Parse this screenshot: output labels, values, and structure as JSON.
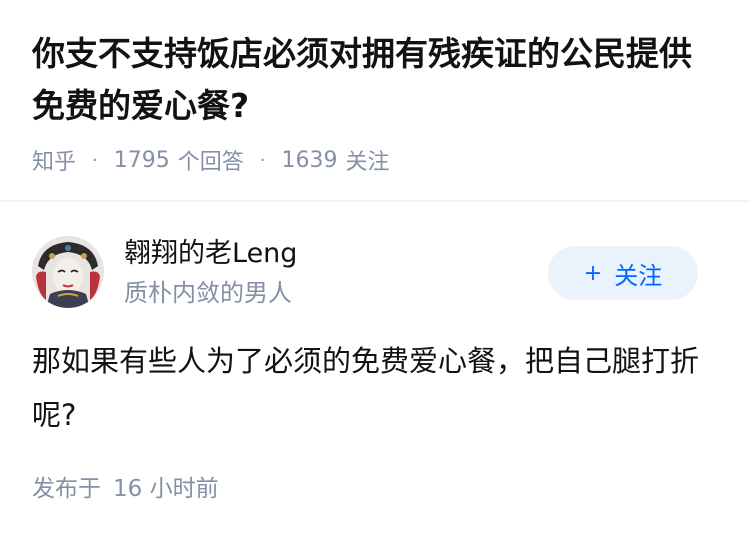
{
  "question": {
    "title": "你支不支持饭店必须对拥有残疾证的公民提供免费的爱心餐?",
    "source": "知乎",
    "answer_count": "1795",
    "answer_label": "个回答",
    "follow_count": "1639",
    "follow_label": "关注"
  },
  "author": {
    "name": "翱翔的老Leng",
    "bio": "质朴内敛的男人",
    "follow_button": {
      "icon": "plus-icon",
      "plus_text": "+",
      "label": "关注",
      "color": "#0066ff",
      "background": "#eaf2fb"
    }
  },
  "answer": {
    "content": "那如果有些人为了必须的免费爱心餐，把自己腿打折呢?",
    "time_prefix": "发布于",
    "time_value": "16 小时前"
  },
  "colors": {
    "meta_text": "#8590a6",
    "primary_text": "#121212",
    "accent": "#0066ff"
  }
}
